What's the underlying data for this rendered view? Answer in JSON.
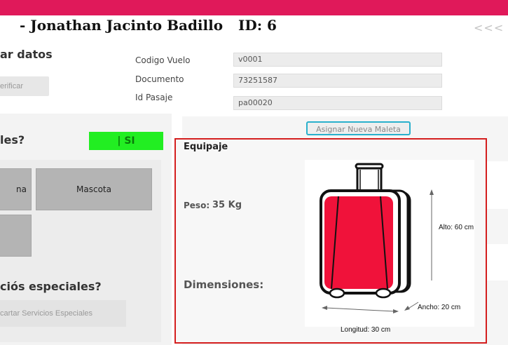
{
  "header": {
    "passenger_name": "- Jonathan Jacinto Badillo",
    "passenger_id": "ID: 6",
    "back_label": "<<<"
  },
  "verify_section": {
    "title": "ar datos",
    "verify_button": "erificar"
  },
  "flight_form": {
    "fields": [
      {
        "label": "Codigo Vuelo",
        "value": "v0001"
      },
      {
        "label": "Documento",
        "value": "73251587"
      },
      {
        "label": "Id Pasaje",
        "value": "pa00020"
      }
    ]
  },
  "special_needs": {
    "question": "les?",
    "toggle_label": "| SI",
    "options": [
      "na",
      "Mascota"
    ]
  },
  "special_services": {
    "question": "ciós especiales?",
    "discard_button": "cartar Servicios Especiales"
  },
  "assign_button": "Asignar Nueva Maleta",
  "luggage": {
    "title": "Equipaje",
    "weight_label": "Peso:",
    "weight_value": "35 Kg",
    "dimensions_label": "Dimensiones:",
    "height": "Alto: 60 cm",
    "width": "Ancho: 20 cm",
    "length": "Longitud: 30 cm"
  },
  "colors": {
    "brand_bar": "#e0195a",
    "toggle_on": "#22ee22",
    "card_border": "#d41e1e",
    "assign_border": "#2ab0cc",
    "suitcase_body": "#f0123a"
  }
}
